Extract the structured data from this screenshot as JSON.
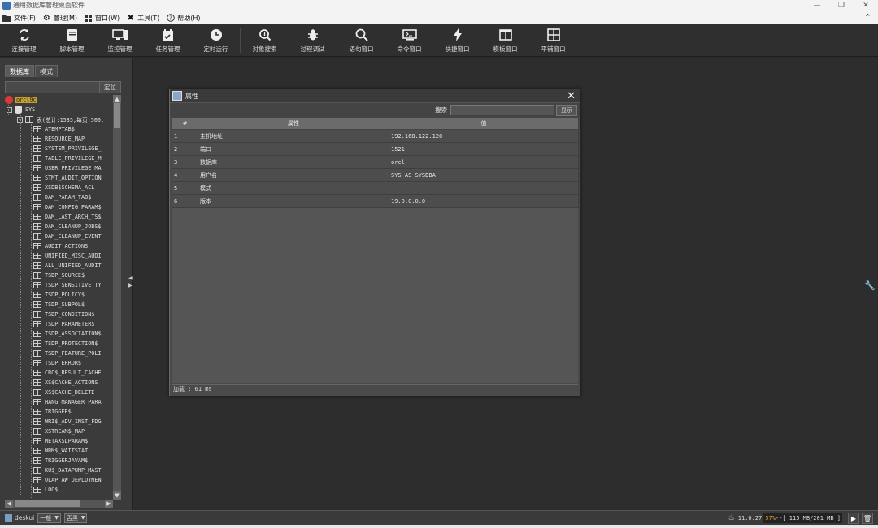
{
  "window": {
    "title": "通用数据库管理桌面软件"
  },
  "menu": [
    {
      "label": "文件(F)",
      "icon": "folder-icon"
    },
    {
      "label": "管理(M)",
      "icon": "gear-icon"
    },
    {
      "label": "窗口(W)",
      "icon": "windows-icon"
    },
    {
      "label": "工具(T)",
      "icon": "tools-icon"
    },
    {
      "label": "帮助(H)",
      "icon": "help-icon"
    }
  ],
  "toolbar": [
    {
      "label": "连接管理",
      "icon": "reconnect-icon"
    },
    {
      "label": "脚本管理",
      "icon": "script-icon"
    },
    {
      "label": "监控管理",
      "icon": "monitor-icon"
    },
    {
      "label": "任务管理",
      "icon": "calendar-check-icon"
    },
    {
      "label": "定时运行",
      "icon": "clock-icon"
    },
    {
      "label": "对象搜索",
      "icon": "object-search-icon"
    },
    {
      "label": "过程调试",
      "icon": "bug-icon"
    },
    {
      "label": "语句窗口",
      "icon": "search-icon"
    },
    {
      "label": "命令窗口",
      "icon": "terminal-icon"
    },
    {
      "label": "快捷窗口",
      "icon": "lightning-icon"
    },
    {
      "label": "模板窗口",
      "icon": "template-icon"
    },
    {
      "label": "平铺窗口",
      "icon": "tile-icon"
    }
  ],
  "left_panel": {
    "tabs": [
      "数据库",
      "模式"
    ],
    "locate_button": "定位",
    "tree": {
      "connection": "orcl9c",
      "schema": "SYS",
      "tables_node": "表(总计:1535,每页:500,",
      "tables": [
        "ATEMPTAB$",
        "RESOURCE_MAP",
        "SYSTEM_PRIVILEGE_",
        "TABLE_PRIVILEGE_M",
        "USER_PRIVILEGE_MA",
        "STMT_AUDIT_OPTION",
        "XSDB$SCHEMA_ACL",
        "DAM_PARAM_TAB$",
        "DAM_CONFIG_PARAM$",
        "DAM_LAST_ARCH_TS$",
        "DAM_CLEANUP_JOBS$",
        "DAM_CLEANUP_EVENT",
        "AUDIT_ACTIONS",
        "UNIFIED_MISC_AUDI",
        "ALL_UNIFIED_AUDIT",
        "TSDP_SOURCE$",
        "TSDP_SENSITIVE_TY",
        "TSDP_POLICY$",
        "TSDP_SUBPOL$",
        "TSDP_CONDITION$",
        "TSDP_PARAMETER$",
        "TSDP_ASSOCIATION$",
        "TSDP_PROTECTION$",
        "TSDP_FEATURE_POLI",
        "TSDP_ERROR$",
        "CRC$_RESULT_CACHE",
        "XS$CACHE_ACTIONS",
        "XS$CACHE_DELETE",
        "HANG_MANAGER_PARA",
        "TRIGGER$",
        "WRI$_ADV_INST_FDG",
        "XSTREAM$_MAP",
        "METAXSLPARAM$",
        "WRM$_WAITSTAT",
        "TRIGGERJAVAM$",
        "KU$_DATAPUMP_MAST",
        "OLAP_AW_DEPLOYMEN",
        "LOC$"
      ]
    }
  },
  "dialog": {
    "title": "属性",
    "search_label": "搜索",
    "search_button": "显示",
    "columns": [
      "#",
      "属性",
      "值"
    ],
    "rows": [
      [
        "1",
        "主机地址",
        "192.168.122.120"
      ],
      [
        "2",
        "端口",
        "1521"
      ],
      [
        "3",
        "数据库",
        "orcl"
      ],
      [
        "4",
        "用户名",
        "SYS AS SYSDBA"
      ],
      [
        "5",
        "模式",
        ""
      ],
      [
        "6",
        "版本",
        "19.0.0.0.0"
      ]
    ],
    "status": "加载 : 61 ms"
  },
  "statusbar": {
    "user": "deskui",
    "mode_select": "一般",
    "theme_select": "否黑",
    "version": "11.0.27",
    "mem_pct": "57%",
    "mem_rest": "--[ 115 MB/201 MB ]"
  }
}
